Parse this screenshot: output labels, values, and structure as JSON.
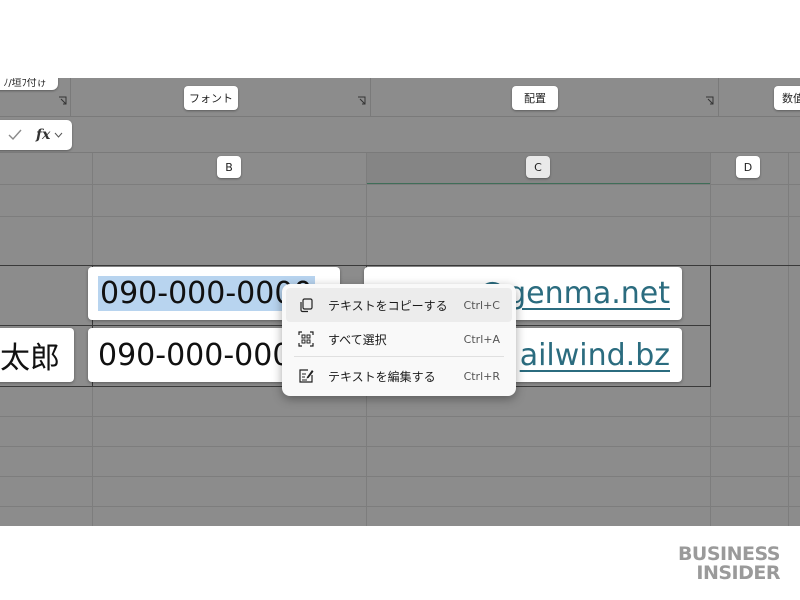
{
  "ribbon": {
    "group_left_partial": "ﾉ/垣ﾌ付ゖ",
    "group_font": "フォント",
    "group_alignment": "配置",
    "group_number_partial": "数值"
  },
  "formula_bar": {
    "fx_label": "fx"
  },
  "columns": {
    "b": "B",
    "c": "C",
    "d": "D"
  },
  "cells": {
    "a_row2_partial": "太郎",
    "b_row1": "090-000-0000",
    "b_row2": "090-000-0000",
    "c_row1_partial": "@genma.net",
    "c_row2_partial": "ailwind.bz"
  },
  "context_menu": {
    "items": [
      {
        "label": "テキストをコピーする",
        "shortcut": "Ctrl+C",
        "icon": "copy-icon"
      },
      {
        "label": "すべて選択",
        "shortcut": "Ctrl+A",
        "icon": "select-all-icon"
      },
      {
        "label": "テキストを編集する",
        "shortcut": "Ctrl+R",
        "icon": "edit-text-icon"
      }
    ]
  },
  "watermark": {
    "line1": "BUSINESS",
    "line2": "INSIDER"
  },
  "colors": {
    "overlay": "#8c8c8c",
    "selection": "#b8d4ef",
    "link": "#2b6c7f",
    "column_c_underline": "#3f6e58"
  }
}
